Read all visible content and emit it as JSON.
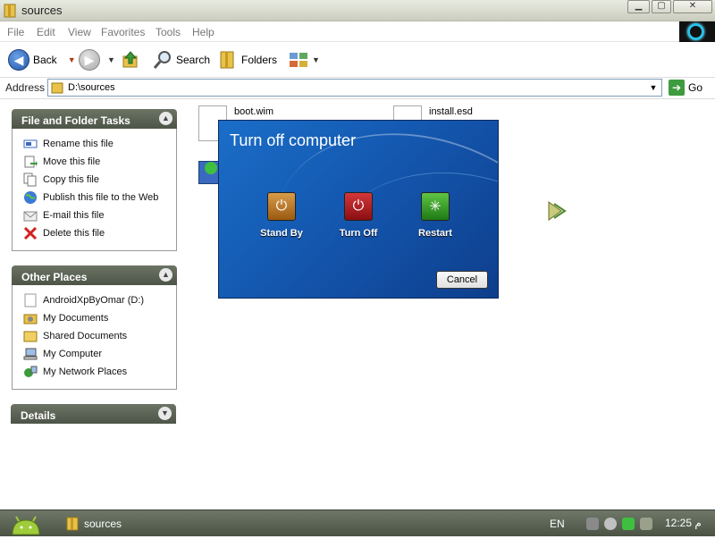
{
  "window": {
    "title": "sources"
  },
  "menu": [
    "File",
    "Edit",
    "View",
    "Favorites",
    "Tools",
    "Help"
  ],
  "toolbar": {
    "back": "Back",
    "search": "Search",
    "folders": "Folders"
  },
  "address": {
    "label": "Address",
    "value": "D:\\sources",
    "go": "Go"
  },
  "tasks": {
    "title": "File and Folder Tasks",
    "items": [
      "Rename this file",
      "Move this file",
      "Copy this file",
      "Publish this file to the Web",
      "E-mail this file",
      "Delete this file"
    ]
  },
  "places": {
    "title": "Other Places",
    "items": [
      "AndroidXpByOmar (D:)",
      "My Documents",
      "Shared Documents",
      "My Computer",
      "My Network Places"
    ]
  },
  "details": {
    "title": "Details"
  },
  "files": [
    "boot.wim",
    "install.esd"
  ],
  "dialog": {
    "title": "Turn off computer",
    "standby": "Stand By",
    "turnoff": "Turn Off",
    "restart": "Restart",
    "cancel": "Cancel"
  },
  "taskbar": {
    "task": "sources",
    "lang": "EN",
    "clock": "12:25 م"
  },
  "colors": {
    "title_bar": "#d6d9cc",
    "panel_header": "#5c6357",
    "dialog_bg": "#1458b0",
    "taskbar": "#5a6254"
  }
}
